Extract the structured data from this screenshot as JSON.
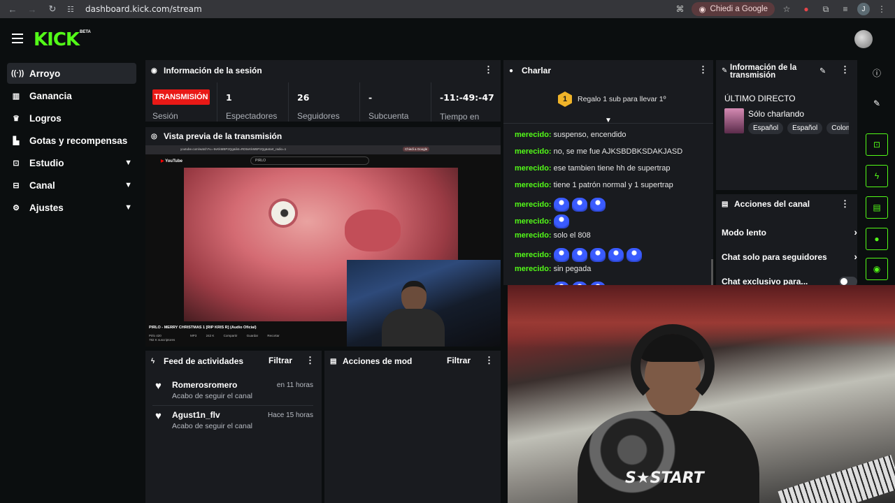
{
  "browser": {
    "url": "dashboard.kick.com/stream",
    "ask_google": "Chiedi a Google",
    "profile_initial": "J"
  },
  "header": {
    "logo": "KICK",
    "logo_badge": "BETA"
  },
  "sidebar": {
    "items": [
      {
        "label": "Arroyo",
        "icon": "stream-icon"
      },
      {
        "label": "Ganancia",
        "icon": "chart-icon"
      },
      {
        "label": "Logros",
        "icon": "trophy-icon"
      },
      {
        "label": "Gotas y recompensas",
        "icon": "gift-icon"
      },
      {
        "label": "Estudio",
        "icon": "studio-icon"
      },
      {
        "label": "Canal",
        "icon": "channel-icon"
      },
      {
        "label": "Ajustes",
        "icon": "gear-icon"
      }
    ]
  },
  "session": {
    "title": "Información de la sesión",
    "live_label": "TRANSMISIÓN",
    "session_label": "Sesión",
    "stats": [
      {
        "value": "1",
        "label": "Espectadores"
      },
      {
        "value": "26",
        "label": "Seguidores"
      },
      {
        "value": "-",
        "label": "Subcuenta"
      },
      {
        "value": "-11:-49:-47",
        "label": "Tiempo en vivo"
      }
    ]
  },
  "preview": {
    "title": "Vista previa de la transmisión",
    "embedded": {
      "yt_url": "youtube.com/watch?v=-5vKkMBP2Qg&list=RD5vKkMBP2Qg&start_radio=1",
      "yt_search": "PIRLO",
      "ask_google": "Chiedi a Google",
      "video_title": "PIRLO - MERRY CHRISTMAS 1 [RIP KRIS R] (Audio Oficial)",
      "channel": "Pirlo 420",
      "subs": "782 K suscriptores",
      "actions": [
        "MP3",
        "242 K",
        "Compartir",
        "Guardar",
        "Recortar"
      ]
    }
  },
  "feed": {
    "title": "Feed de actividades",
    "filter": "Filtrar",
    "items": [
      {
        "name": "Romerosromero",
        "sub": "Acabo de seguir el canal",
        "time": "en 11 horas"
      },
      {
        "name": "Agust1n_flv",
        "sub": "Acabo de seguir el canal",
        "time": "Hace 15 horas"
      }
    ]
  },
  "mod": {
    "title": "Acciones de mod",
    "filter": "Filtrar"
  },
  "chat": {
    "title": "Charlar",
    "gift_number": "1",
    "gift_text": "Regalo 1 sub para llevar 1º",
    "messages": [
      {
        "user": "merecido:",
        "text": "suspenso, encendido",
        "emotes": 0
      },
      {
        "user": "merecido:",
        "text": "no, se me fue AJKSBDBKSDAKJASD",
        "emotes": 0
      },
      {
        "user": "merecido:",
        "text": "ese tambien tiene hh de supertrap",
        "emotes": 0
      },
      {
        "user": "merecido:",
        "text": "tiene 1 patrón normal y 1 supertrap",
        "emotes": 0
      },
      {
        "user": "merecido:",
        "text": "",
        "emotes": 3
      },
      {
        "user": "merecido:",
        "text": "",
        "emotes": 1
      },
      {
        "user": "merecido:",
        "text": "solo el 808",
        "emotes": 0
      },
      {
        "user": "merecido:",
        "text": "",
        "emotes": 5
      },
      {
        "user": "merecido:",
        "text": "sin pegada",
        "emotes": 0
      },
      {
        "user": "merecido:",
        "text": "",
        "emotes": 3
      }
    ]
  },
  "stream_info": {
    "title": "Información de la transmisión",
    "last_live": "ÚLTIMO DIRECTO",
    "stream_name": "Sólo charlando",
    "tags": [
      "Español",
      "Español",
      "Colombia"
    ]
  },
  "channel_actions": {
    "title": "Acciones del canal",
    "rows": [
      {
        "label": "Modo lento",
        "kind": "chevron"
      },
      {
        "label": "Chat solo para seguidores",
        "kind": "chevron"
      },
      {
        "label": "Chat exclusivo para...",
        "kind": "toggle",
        "on": false
      }
    ]
  },
  "colors": {
    "accent": "#53fc18",
    "live": "#e91916",
    "panel": "#191b1f",
    "background": "#0b0e0f"
  }
}
